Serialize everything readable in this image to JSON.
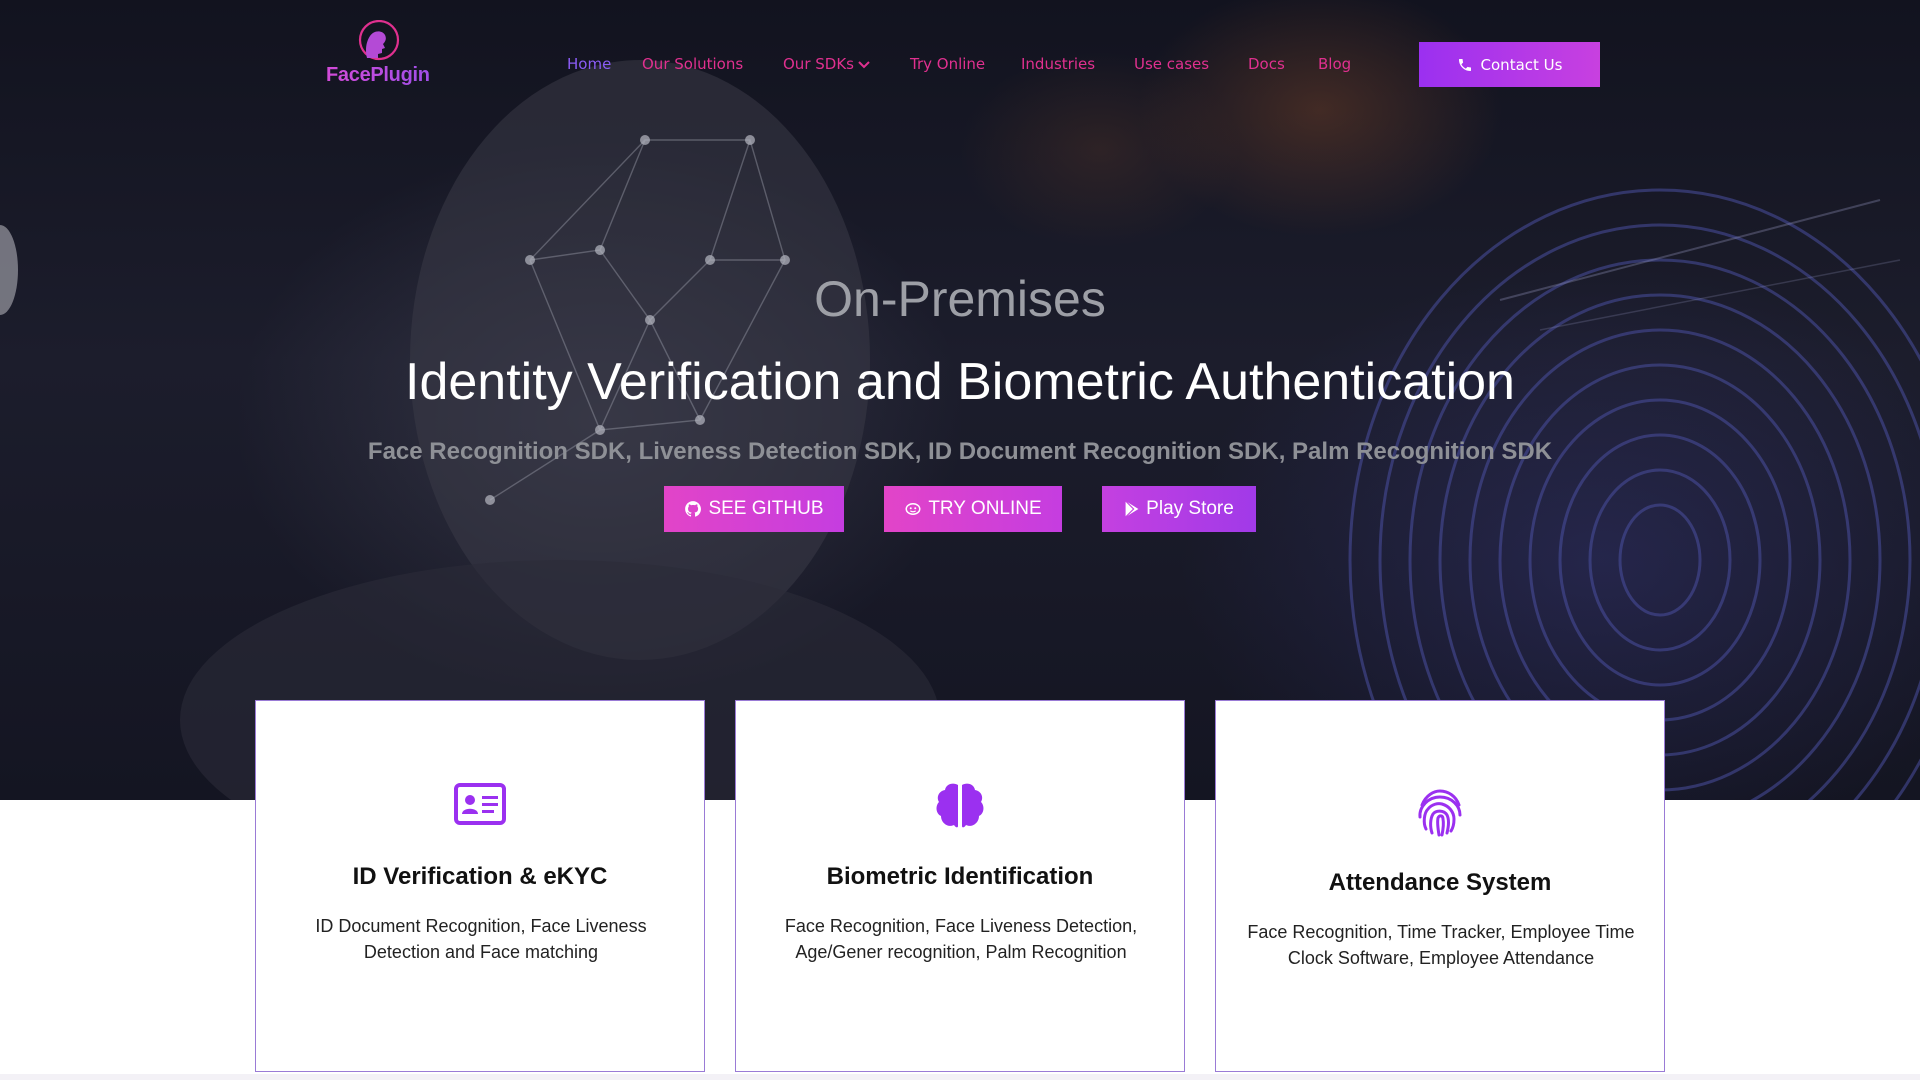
{
  "brand": {
    "name": "FacePlugin",
    "accent": "#9b30f0",
    "pink": "#e0308f"
  },
  "nav": {
    "items": [
      {
        "label": "Home",
        "active": true
      },
      {
        "label": "Our Solutions"
      },
      {
        "label": "Our SDKs",
        "has_dropdown": true
      },
      {
        "label": "Try Online"
      },
      {
        "label": "Industries"
      },
      {
        "label": "Use cases"
      },
      {
        "label": "Docs"
      },
      {
        "label": "Blog"
      }
    ],
    "contact_label": "Contact Us",
    "contact_icon": "phone-icon"
  },
  "hero": {
    "eyebrow": "On-Premises",
    "title": "Identity Verification and Biometric Authentication",
    "subtitle": "Face Recognition SDK, Liveness Detection SDK, ID Document Recognition SDK, Palm Recognition SDK",
    "buttons": [
      {
        "label": "SEE GITHUB",
        "icon": "github-icon"
      },
      {
        "label": "TRY ONLINE",
        "icon": "face-scan-icon"
      },
      {
        "label": "Play Store",
        "icon": "play-store-icon"
      }
    ]
  },
  "cards": [
    {
      "icon": "id-card-icon",
      "title": "ID Verification & eKYC",
      "description": "ID Document Recognition, Face Liveness Detection and Face matching"
    },
    {
      "icon": "brain-icon",
      "title": "Biometric Identification",
      "description": "Face Recognition, Face Liveness Detection, Age/Gener recognition, Palm Recognition"
    },
    {
      "icon": "fingerprint-icon",
      "title": "Attendance System",
      "description": "Face Recognition, Time Tracker, Employee Time Clock Software, Employee Attendance"
    }
  ]
}
